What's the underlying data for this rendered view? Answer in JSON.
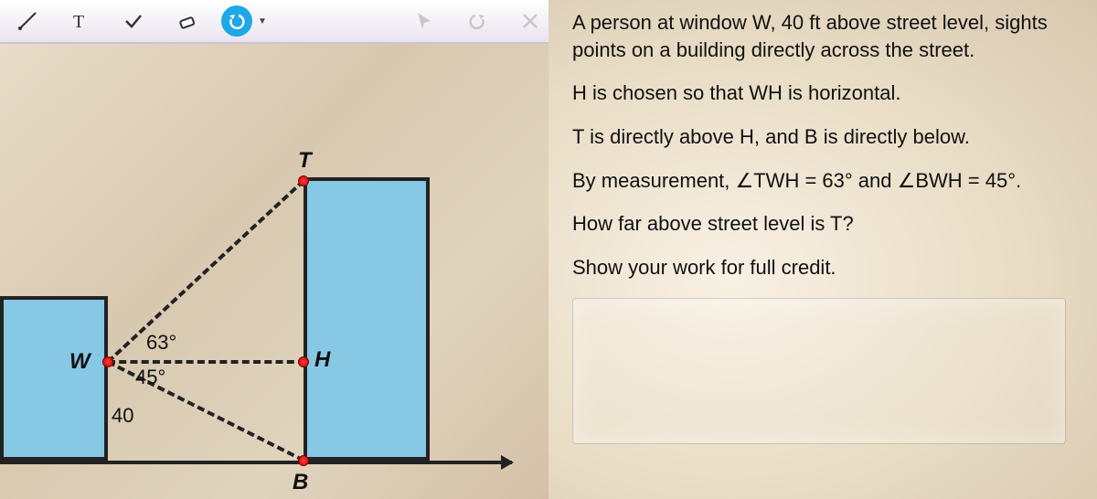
{
  "toolbar": {
    "undo_label": "undo"
  },
  "figure": {
    "point_T": "T",
    "point_W": "W",
    "point_H": "H",
    "point_B": "B",
    "angle_top": "63°",
    "angle_bottom": "45°",
    "height_label": "40"
  },
  "problem": {
    "p1": "A person at window W, 40 ft above street level, sights points on a building directly across the street.",
    "p2": "H is chosen so that WH is horizontal.",
    "p3": "T is directly above H, and B is directly below.",
    "p4": "By measurement, ∠TWH = 63° and ∠BWH = 45°.",
    "p5": "How far above street level is T?",
    "p6": "Show your work for full credit."
  },
  "chart_data": {
    "type": "diagram",
    "description": "Geometry word-problem figure: observer at W (40 ft above street) looks across to building with points T (top), H (horizontal), B (bottom).",
    "given": {
      "W_height_ft": 40,
      "angle_TWH_deg": 63,
      "angle_BWH_deg": 45
    },
    "points": [
      "T",
      "W",
      "H",
      "B"
    ],
    "question": "Height of T above street level"
  }
}
